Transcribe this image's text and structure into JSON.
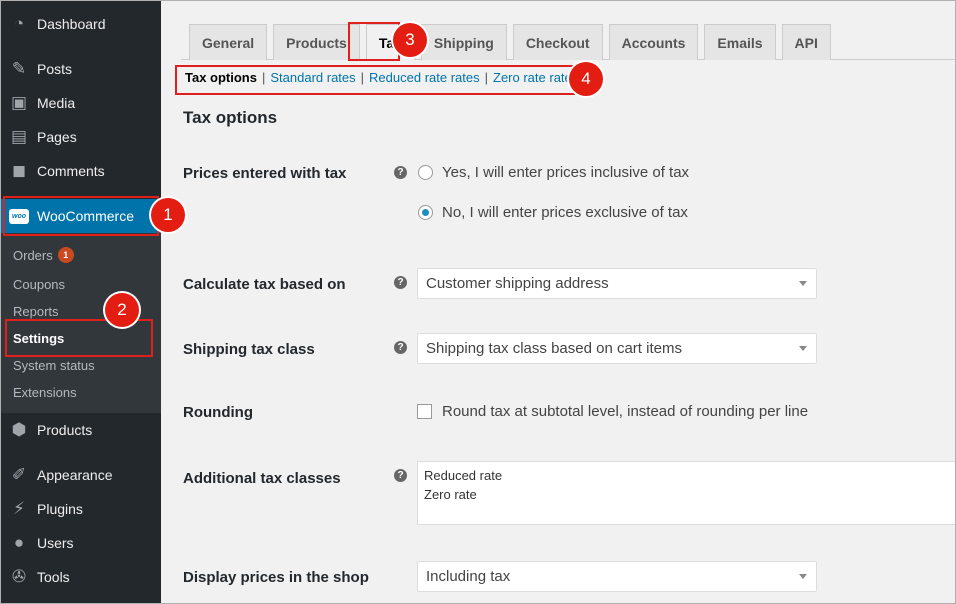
{
  "sidebar": {
    "items": [
      {
        "label": "Dashboard",
        "icon": "dashboard-icon"
      },
      {
        "label": "Posts",
        "icon": "pin-icon"
      },
      {
        "label": "Media",
        "icon": "media-icon"
      },
      {
        "label": "Pages",
        "icon": "pages-icon"
      },
      {
        "label": "Comments",
        "icon": "comment-icon"
      },
      {
        "label": "WooCommerce",
        "icon": "woo-icon",
        "logo_text": "woo"
      },
      {
        "label": "Products",
        "icon": "box-icon"
      },
      {
        "label": "Appearance",
        "icon": "brush-icon"
      },
      {
        "label": "Plugins",
        "icon": "plug-icon"
      },
      {
        "label": "Users",
        "icon": "user-icon"
      },
      {
        "label": "Tools",
        "icon": "wrench-icon"
      }
    ],
    "submenu": [
      {
        "label": "Orders",
        "badge": "1"
      },
      {
        "label": "Coupons"
      },
      {
        "label": "Reports"
      },
      {
        "label": "Settings"
      },
      {
        "label": "System status"
      },
      {
        "label": "Extensions"
      }
    ]
  },
  "tabs": [
    "General",
    "Products",
    "Tax",
    "Shipping",
    "Checkout",
    "Accounts",
    "Emails",
    "API"
  ],
  "active_tab": "Tax",
  "subsections": {
    "current": "Tax options",
    "links": [
      "Standard rates",
      "Reduced rate rates",
      "Zero rate rates"
    ],
    "separator": "|"
  },
  "section_title": "Tax options",
  "form": {
    "prices_entered": {
      "label": "Prices entered with tax",
      "options": [
        "Yes, I will enter prices inclusive of tax",
        "No, I will enter prices exclusive of tax"
      ],
      "selected_index": 1
    },
    "calc_based_on": {
      "label": "Calculate tax based on",
      "value": "Customer shipping address"
    },
    "shipping_tax_class": {
      "label": "Shipping tax class",
      "value": "Shipping tax class based on cart items"
    },
    "rounding": {
      "label": "Rounding",
      "checkbox_label": "Round tax at subtotal level, instead of rounding per line",
      "checked": false
    },
    "additional_classes": {
      "label": "Additional tax classes",
      "lines": [
        "Reduced rate",
        "Zero rate"
      ]
    },
    "display_prices": {
      "label": "Display prices in the shop",
      "value": "Including tax"
    }
  },
  "help_glyph": "?",
  "annotations": [
    "1",
    "2",
    "3",
    "4"
  ],
  "colors": {
    "sidebar": "#23282d",
    "active": "#0073aa",
    "link": "#0073aa",
    "highlight": "#e0201c",
    "marker": "#e41d12"
  }
}
